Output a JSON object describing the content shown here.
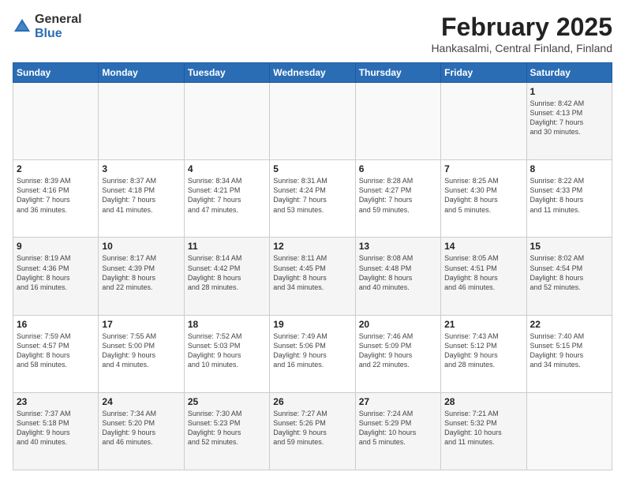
{
  "logo": {
    "general": "General",
    "blue": "Blue"
  },
  "header": {
    "month": "February 2025",
    "location": "Hankasalmi, Central Finland, Finland"
  },
  "days_of_week": [
    "Sunday",
    "Monday",
    "Tuesday",
    "Wednesday",
    "Thursday",
    "Friday",
    "Saturday"
  ],
  "weeks": [
    [
      {
        "day": "",
        "info": ""
      },
      {
        "day": "",
        "info": ""
      },
      {
        "day": "",
        "info": ""
      },
      {
        "day": "",
        "info": ""
      },
      {
        "day": "",
        "info": ""
      },
      {
        "day": "",
        "info": ""
      },
      {
        "day": "1",
        "info": "Sunrise: 8:42 AM\nSunset: 4:13 PM\nDaylight: 7 hours\nand 30 minutes."
      }
    ],
    [
      {
        "day": "2",
        "info": "Sunrise: 8:39 AM\nSunset: 4:16 PM\nDaylight: 7 hours\nand 36 minutes."
      },
      {
        "day": "3",
        "info": "Sunrise: 8:37 AM\nSunset: 4:18 PM\nDaylight: 7 hours\nand 41 minutes."
      },
      {
        "day": "4",
        "info": "Sunrise: 8:34 AM\nSunset: 4:21 PM\nDaylight: 7 hours\nand 47 minutes."
      },
      {
        "day": "5",
        "info": "Sunrise: 8:31 AM\nSunset: 4:24 PM\nDaylight: 7 hours\nand 53 minutes."
      },
      {
        "day": "6",
        "info": "Sunrise: 8:28 AM\nSunset: 4:27 PM\nDaylight: 7 hours\nand 59 minutes."
      },
      {
        "day": "7",
        "info": "Sunrise: 8:25 AM\nSunset: 4:30 PM\nDaylight: 8 hours\nand 5 minutes."
      },
      {
        "day": "8",
        "info": "Sunrise: 8:22 AM\nSunset: 4:33 PM\nDaylight: 8 hours\nand 11 minutes."
      }
    ],
    [
      {
        "day": "9",
        "info": "Sunrise: 8:19 AM\nSunset: 4:36 PM\nDaylight: 8 hours\nand 16 minutes."
      },
      {
        "day": "10",
        "info": "Sunrise: 8:17 AM\nSunset: 4:39 PM\nDaylight: 8 hours\nand 22 minutes."
      },
      {
        "day": "11",
        "info": "Sunrise: 8:14 AM\nSunset: 4:42 PM\nDaylight: 8 hours\nand 28 minutes."
      },
      {
        "day": "12",
        "info": "Sunrise: 8:11 AM\nSunset: 4:45 PM\nDaylight: 8 hours\nand 34 minutes."
      },
      {
        "day": "13",
        "info": "Sunrise: 8:08 AM\nSunset: 4:48 PM\nDaylight: 8 hours\nand 40 minutes."
      },
      {
        "day": "14",
        "info": "Sunrise: 8:05 AM\nSunset: 4:51 PM\nDaylight: 8 hours\nand 46 minutes."
      },
      {
        "day": "15",
        "info": "Sunrise: 8:02 AM\nSunset: 4:54 PM\nDaylight: 8 hours\nand 52 minutes."
      }
    ],
    [
      {
        "day": "16",
        "info": "Sunrise: 7:59 AM\nSunset: 4:57 PM\nDaylight: 8 hours\nand 58 minutes."
      },
      {
        "day": "17",
        "info": "Sunrise: 7:55 AM\nSunset: 5:00 PM\nDaylight: 9 hours\nand 4 minutes."
      },
      {
        "day": "18",
        "info": "Sunrise: 7:52 AM\nSunset: 5:03 PM\nDaylight: 9 hours\nand 10 minutes."
      },
      {
        "day": "19",
        "info": "Sunrise: 7:49 AM\nSunset: 5:06 PM\nDaylight: 9 hours\nand 16 minutes."
      },
      {
        "day": "20",
        "info": "Sunrise: 7:46 AM\nSunset: 5:09 PM\nDaylight: 9 hours\nand 22 minutes."
      },
      {
        "day": "21",
        "info": "Sunrise: 7:43 AM\nSunset: 5:12 PM\nDaylight: 9 hours\nand 28 minutes."
      },
      {
        "day": "22",
        "info": "Sunrise: 7:40 AM\nSunset: 5:15 PM\nDaylight: 9 hours\nand 34 minutes."
      }
    ],
    [
      {
        "day": "23",
        "info": "Sunrise: 7:37 AM\nSunset: 5:18 PM\nDaylight: 9 hours\nand 40 minutes."
      },
      {
        "day": "24",
        "info": "Sunrise: 7:34 AM\nSunset: 5:20 PM\nDaylight: 9 hours\nand 46 minutes."
      },
      {
        "day": "25",
        "info": "Sunrise: 7:30 AM\nSunset: 5:23 PM\nDaylight: 9 hours\nand 52 minutes."
      },
      {
        "day": "26",
        "info": "Sunrise: 7:27 AM\nSunset: 5:26 PM\nDaylight: 9 hours\nand 59 minutes."
      },
      {
        "day": "27",
        "info": "Sunrise: 7:24 AM\nSunset: 5:29 PM\nDaylight: 10 hours\nand 5 minutes."
      },
      {
        "day": "28",
        "info": "Sunrise: 7:21 AM\nSunset: 5:32 PM\nDaylight: 10 hours\nand 11 minutes."
      },
      {
        "day": "",
        "info": ""
      }
    ]
  ]
}
